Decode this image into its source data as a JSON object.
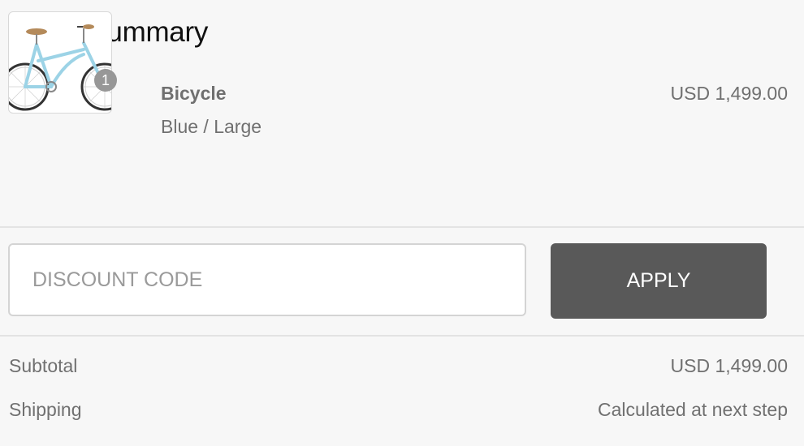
{
  "title": "Order Summary",
  "item": {
    "name": "Bicycle",
    "variant": "Blue / Large",
    "price": "USD 1,499.00",
    "quantity": "1",
    "image_icon": "bicycle-image"
  },
  "discount": {
    "placeholder": "DISCOUNT CODE",
    "value": "",
    "apply_label": "APPLY"
  },
  "totals": {
    "subtotal_label": "Subtotal",
    "subtotal_value": "USD 1,499.00",
    "shipping_label": "Shipping",
    "shipping_value": "Calculated at next step"
  },
  "colors": {
    "apply_button": "#595959",
    "badge": "#979797",
    "background": "#f7f7f7",
    "bicycle_frame": "#9cd3e6"
  }
}
